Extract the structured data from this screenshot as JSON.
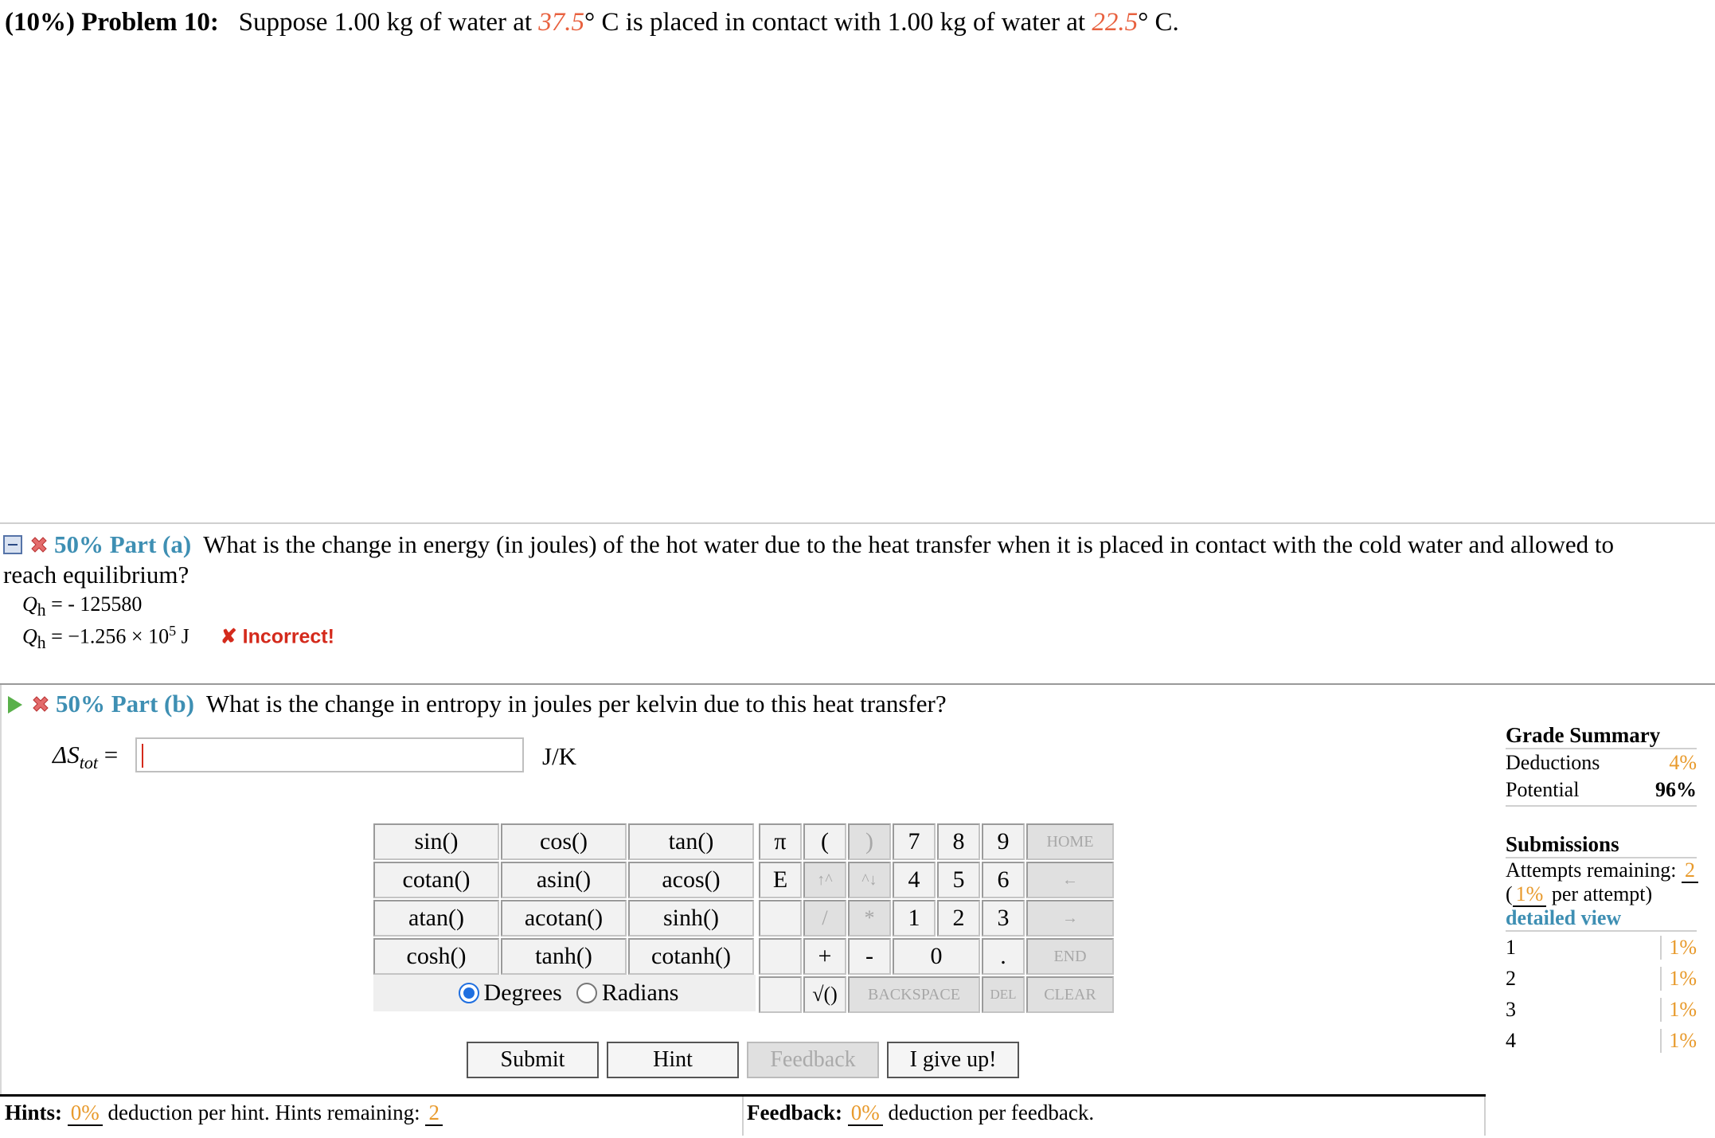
{
  "problem": {
    "label": "(10%) Problem 10:",
    "text_prefix": "Suppose 1.00 kg of water at",
    "temp_hot": "37.5",
    "text_middle": "° C is placed in contact with 1.00 kg of water at",
    "temp_cold": "22.5",
    "text_suffix": "° C."
  },
  "part_a": {
    "percent": "50%",
    "label": "Part (a)",
    "question_line1": "What is the change in energy (in joules) of the hot water due to the heat transfer when it is placed in contact with the cold water and allowed to",
    "question_line2": "reach equilibrium?",
    "answer_var": "Q",
    "answer_sub": "h",
    "entered_value": " = - 125580",
    "formatted_value": " = −1.256 × 10",
    "formatted_exp": "5",
    "formatted_unit": " J",
    "status": "✘ Incorrect!"
  },
  "part_b": {
    "percent": "50%",
    "label": "Part (b)",
    "question": "What is the change in entropy in joules per kelvin due to this heat transfer?",
    "input_var": "ΔS",
    "input_sub": "tot",
    "input_eq": " =",
    "input_value": "",
    "unit": "J/K"
  },
  "calculator": {
    "functions": [
      [
        "sin()",
        "cos()",
        "tan()"
      ],
      [
        "cotan()",
        "asin()",
        "acos()"
      ],
      [
        "atan()",
        "acotan()",
        "sinh()"
      ],
      [
        "cosh()",
        "tanh()",
        "cotanh()"
      ]
    ],
    "keys": {
      "pi": "π",
      "lparen": "(",
      "rparen": ")",
      "k7": "7",
      "k8": "8",
      "k9": "9",
      "home": "HOME",
      "e": "E",
      "up": "↑^",
      "down": "^↓",
      "k4": "4",
      "k5": "5",
      "k6": "6",
      "left": "←",
      "div": "/",
      "mul": "*",
      "k1": "1",
      "k2": "2",
      "k3": "3",
      "right": "→",
      "plus": "+",
      "minus": "-",
      "k0": "0",
      "dot": ".",
      "end": "END",
      "sqrt": "√()",
      "backspace": "BACKSPACE",
      "del": "DEL",
      "clear": "CLEAR"
    },
    "angle_degrees": "Degrees",
    "angle_radians": "Radians"
  },
  "actions": {
    "submit": "Submit",
    "hint": "Hint",
    "feedback": "Feedback",
    "give_up": "I give up!"
  },
  "hints": {
    "label": "Hints:",
    "deduction": "0%",
    "text": "deduction per hint. Hints remaining:",
    "remaining": "2"
  },
  "feedback": {
    "label": "Feedback:",
    "deduction": "0%",
    "text": "deduction per feedback."
  },
  "grade_summary": {
    "title": "Grade Summary",
    "deductions_label": "Deductions",
    "deductions_value": "4%",
    "potential_label": "Potential",
    "potential_value": "96%",
    "submissions_title": "Submissions",
    "attempts_label": "Attempts remaining:",
    "attempts_value": "2",
    "per_attempt_open": "(",
    "per_attempt_value": "1%",
    "per_attempt_text": " per attempt)",
    "detailed_view": "detailed view",
    "rows": [
      {
        "n": "1",
        "v": "1%"
      },
      {
        "n": "2",
        "v": "1%"
      },
      {
        "n": "3",
        "v": "1%"
      },
      {
        "n": "4",
        "v": "1%"
      }
    ]
  },
  "colors": {
    "temperature": "#e8613f",
    "part_heading": "#3e8fb3",
    "percent_values": "#e89a2c",
    "incorrect": "#d42a1c"
  }
}
